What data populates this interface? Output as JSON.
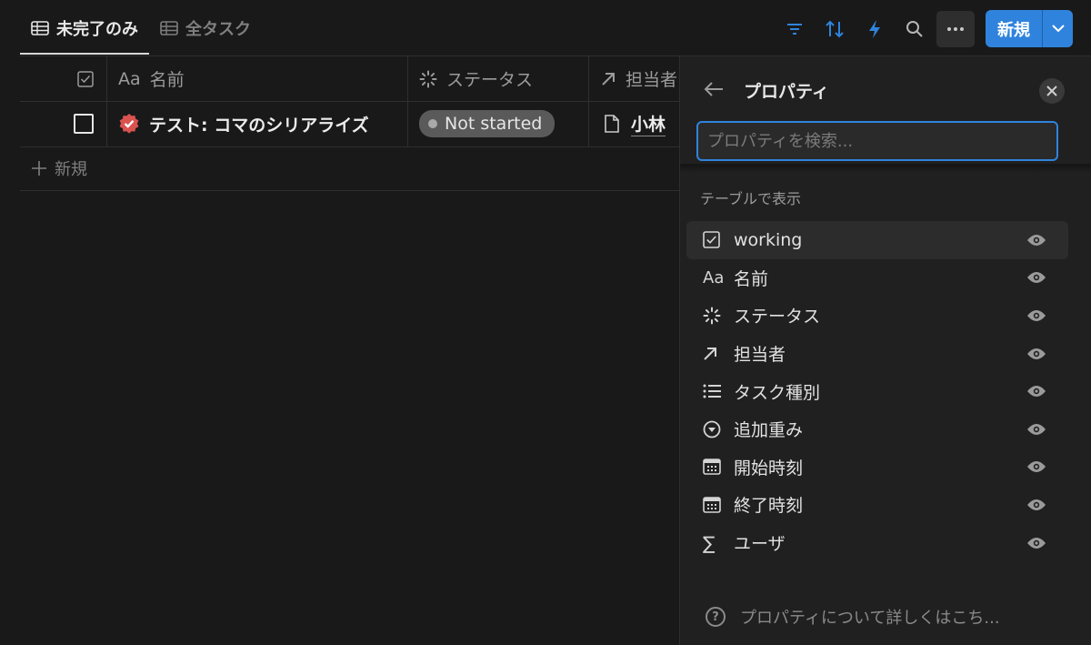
{
  "tabs": [
    {
      "label": "未完了のみ",
      "active": true
    },
    {
      "label": "全タスク",
      "active": false
    }
  ],
  "toolbar": {
    "icons": [
      "filter-icon",
      "sort-icon",
      "lightning-icon",
      "search-icon",
      "more-icon"
    ],
    "new_label": "新規",
    "accent": "#2f83dd"
  },
  "table": {
    "columns": [
      {
        "icon": "checkbox-icon",
        "label": ""
      },
      {
        "icon": "text-icon",
        "icon_text": "Aa",
        "label": "名前"
      },
      {
        "icon": "status-icon",
        "label": "ステータス"
      },
      {
        "icon": "arrow-icon",
        "label": "担当者"
      }
    ],
    "rows": [
      {
        "name": "テスト: コマのシリアライズ",
        "status": "Not started",
        "owner": "小林"
      }
    ],
    "new_row_label": "新規"
  },
  "panel": {
    "title": "プロパティ",
    "search_placeholder": "プロパティを検索...",
    "section_label": "テーブルで表示",
    "properties": [
      {
        "icon": "checkbox-icon",
        "label": "working"
      },
      {
        "icon": "text-icon",
        "icon_text": "Aa",
        "label": "名前"
      },
      {
        "icon": "status-icon",
        "label": "ステータス"
      },
      {
        "icon": "arrow-icon",
        "label": "担当者"
      },
      {
        "icon": "list-icon",
        "label": "タスク種別"
      },
      {
        "icon": "select-icon",
        "label": "追加重み"
      },
      {
        "icon": "calendar-icon",
        "label": "開始時刻"
      },
      {
        "icon": "calendar-icon",
        "label": "終了時刻"
      },
      {
        "icon": "sigma-icon",
        "icon_text": "∑",
        "label": "ユーザ"
      }
    ],
    "footer": "プロパティについて詳しくはこち..."
  }
}
